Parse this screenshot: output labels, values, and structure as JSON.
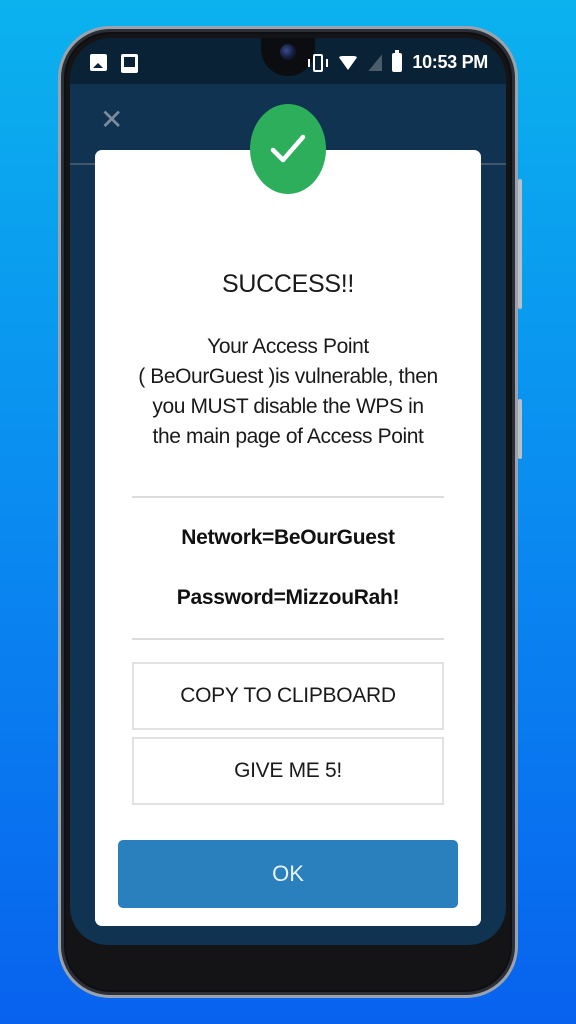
{
  "status_bar": {
    "left_icons": [
      "image-notification-icon",
      "terminal-notification-icon"
    ],
    "right_icons": [
      "vibrate-icon",
      "wifi-icon",
      "no-signal-icon",
      "battery-icon"
    ],
    "time": "10:53 PM"
  },
  "background_screen": {
    "close_icon": "close-icon"
  },
  "dialog": {
    "badge_icon": "checkmark-icon",
    "badge_color": "#2dae5a",
    "title": "SUCCESS!!",
    "message_lines": [
      "Your Access Point",
      "( BeOurGuest )is vulnerable, then",
      "you MUST disable the WPS in",
      "the main page of Access Point"
    ],
    "network_line": "Network=BeOurGuest",
    "password_line": "Password=MizzouRah!",
    "buttons": {
      "copy": "COPY TO CLIPBOARD",
      "give_five": "GIVE ME 5!",
      "ok": "OK"
    },
    "ok_color": "#2a80bd"
  }
}
